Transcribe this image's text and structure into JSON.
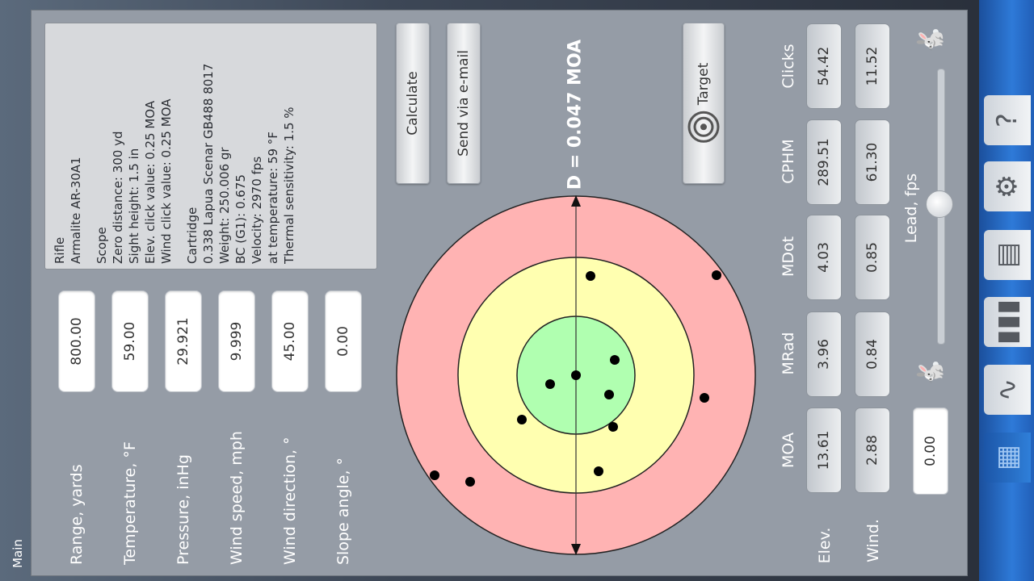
{
  "screen": {
    "main_label": "Main"
  },
  "info": {
    "lines": [
      "Rifle",
      "Armalite AR-30A1",
      "",
      "Scope",
      "Zero distance: 300 yd",
      "Sight height: 1.5 in",
      "Elev. click value: 0.25 MOA",
      "Wind click value: 0.25 MOA",
      "",
      "Cartridge",
      "0.338 Lapua Scenar GB488 8017",
      "Weight: 250.006 gr",
      "BC (G1): 0.675",
      "Velocity: 2970 fps",
      "at temperature: 59 °F",
      "Thermal sensitivity: 1.5 %"
    ]
  },
  "inputs": [
    {
      "label": "Range, yards",
      "value": "800.00"
    },
    {
      "label": "Temperature, °F",
      "value": "59.00"
    },
    {
      "label": "Pressure, inHg",
      "value": "29.921"
    },
    {
      "label": "Wind speed, mph",
      "value": "9.999"
    },
    {
      "label": "Wind direction, °",
      "value": "45.00"
    },
    {
      "label": "Slope angle, °",
      "value": "0.00"
    }
  ],
  "buttons": {
    "calculate": "Calculate",
    "email": "Send via e-mail",
    "target": "Target"
  },
  "target": {
    "distance_label": "D = 0.047 MOA",
    "colors": {
      "outer": "#ffb3b3",
      "middle": "#ffffb0",
      "inner": "#b0ffb0"
    }
  },
  "results": {
    "headers": [
      "MOA",
      "MRad",
      "MDot",
      "CPHM",
      "Clicks"
    ],
    "rows": [
      {
        "label": "Elev.",
        "values": [
          "13.61",
          "3.96",
          "4.03",
          "289.51",
          "54.42"
        ]
      },
      {
        "label": "Wind.",
        "values": [
          "2.88",
          "0.84",
          "0.85",
          "61.30",
          "11.52"
        ]
      }
    ]
  },
  "lead": {
    "label": "Lead, fps",
    "value": "0.00",
    "level": 0.5
  },
  "rail": [
    "help-icon",
    "settings-icon",
    "list-icon",
    "cartridges-icon",
    "rifle-icon",
    "calculator-icon"
  ]
}
